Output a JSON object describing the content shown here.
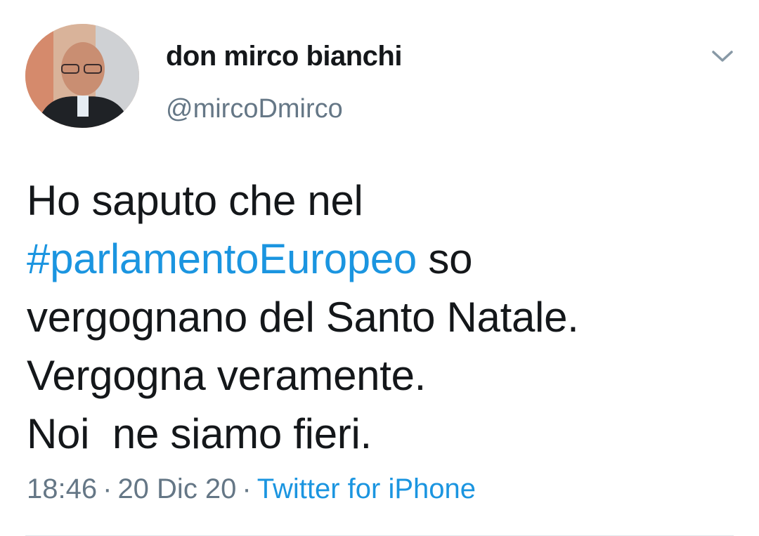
{
  "author": {
    "display_name": "don mirco bianchi",
    "handle": "@mircoDmirco",
    "avatar_icon": "profile-photo"
  },
  "menu_icon": "chevron-down-icon",
  "tweet": {
    "line1": "Ho saputo che nel",
    "hashtag": "#parlamentoEuropeo",
    "after_hashtag": " so",
    "line3": "vergognano del Santo Natale.",
    "line4": "Vergogna veramente.",
    "line5": "Noi  ne siamo fieri."
  },
  "meta": {
    "time": "18:46",
    "separator": "·",
    "date": "20 Dic 20",
    "source": "Twitter for iPhone"
  },
  "colors": {
    "link": "#1b95e0",
    "secondary_text": "#657786",
    "primary_text": "#14171a"
  }
}
